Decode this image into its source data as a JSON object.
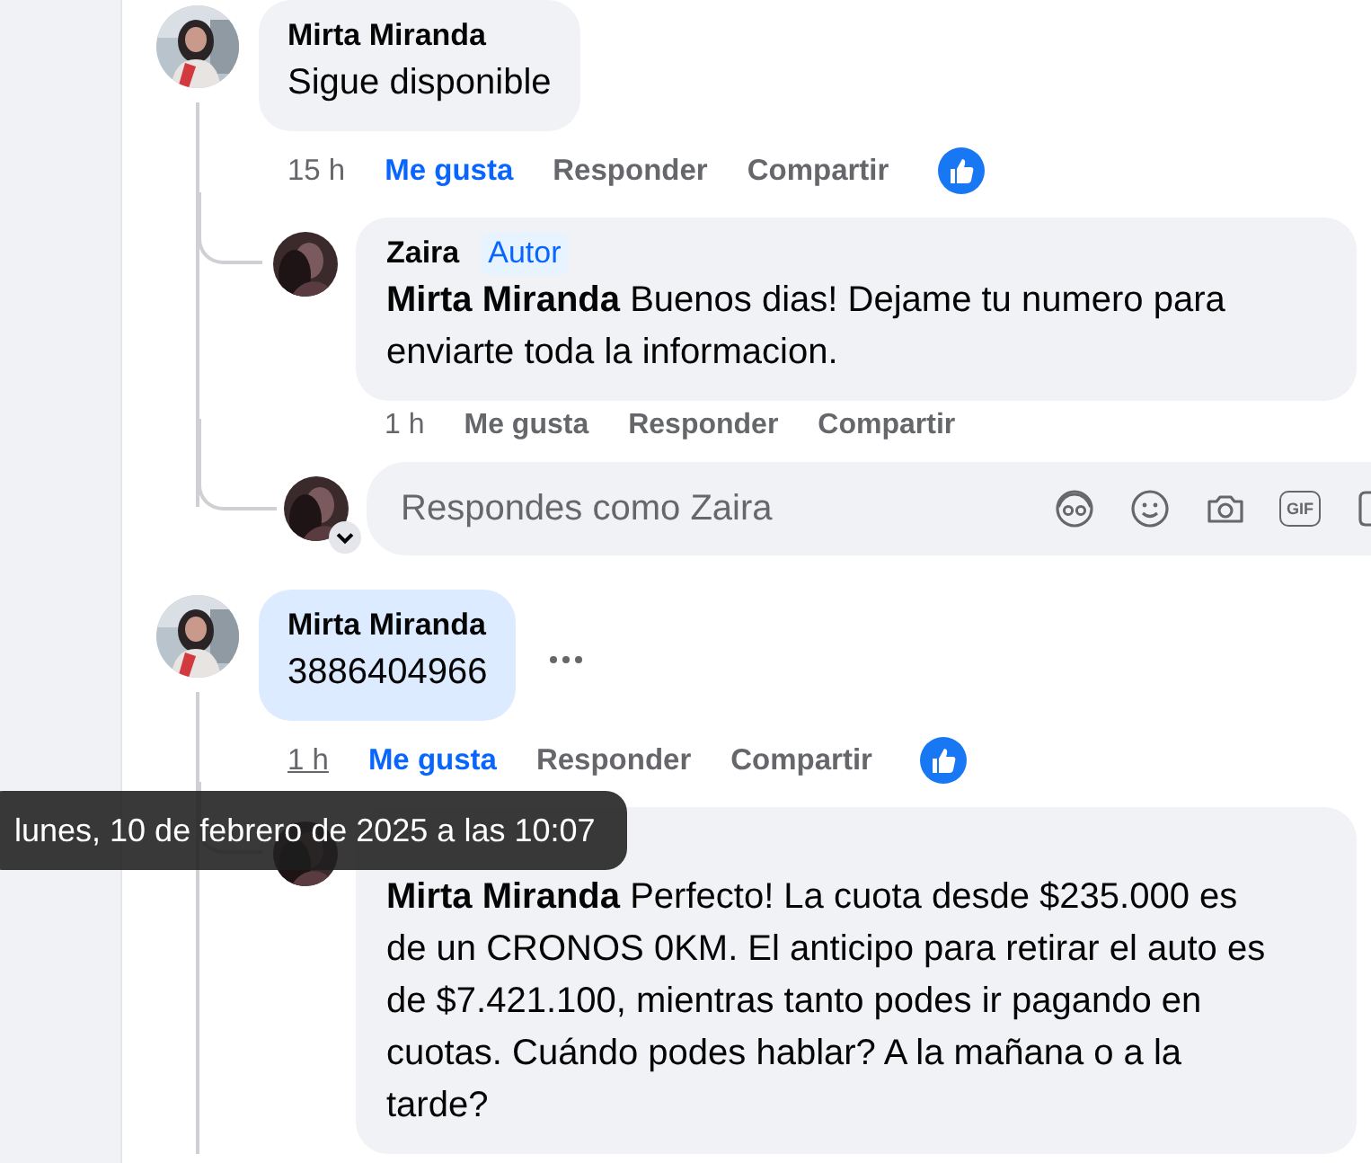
{
  "comments": [
    {
      "author": "Mirta Miranda",
      "text": "Sigue disponible",
      "highlighted": false,
      "time": "15 h",
      "time_hovered": false,
      "like_label": "Me gusta",
      "liked": true,
      "reply_label": "Responder",
      "share_label": "Compartir",
      "has_reaction": true,
      "replies": [
        {
          "author": "Zaira",
          "badge": "Autor",
          "text": "**Mirta Miranda** Buenos dias! Dejame tu numero para enviarte toda la informacion.",
          "time": "1 h",
          "like_label": "Me gusta",
          "liked": false,
          "reply_label": "Responder",
          "share_label": "Compartir"
        }
      ],
      "composer": {
        "placeholder": "Respondes como Zaira",
        "gif_label": "GIF"
      }
    },
    {
      "author": "Mirta Miranda",
      "text": "3886404966",
      "highlighted": true,
      "more_button": true,
      "time": "1 h",
      "time_hovered": true,
      "like_label": "Me gusta",
      "liked": true,
      "reply_label": "Responder",
      "share_label": "Compartir",
      "has_reaction": true,
      "replies": [
        {
          "text": "**Mirta Miranda** Perfecto! La cuota desde $235.000 es de un CRONOS 0KM. El anticipo para retirar el auto es de $7.421.100, mientras tanto podes ir pagando en cuotas. Cuándo podes hablar? A la mañana o a la tarde?"
        }
      ]
    }
  ],
  "tooltip": {
    "text": "lunes, 10 de febrero de 2025 a las 10:07"
  }
}
